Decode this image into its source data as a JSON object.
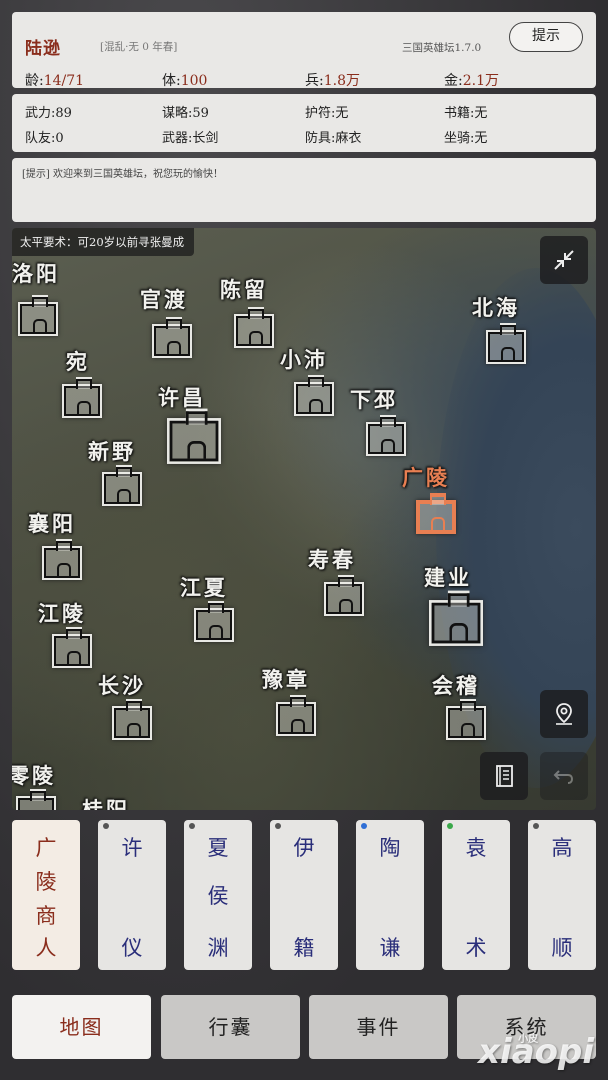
{
  "header": {
    "name": "陆逊",
    "era": "[混乱·无 0 年春]",
    "version": "三国英雄坛1.7.0",
    "hint_button": "提示",
    "stats": [
      {
        "label": "龄:",
        "value": "14/71"
      },
      {
        "label": "体:",
        "value": "100"
      },
      {
        "label": "兵:",
        "value": "1.8万"
      },
      {
        "label": "金:",
        "value": "2.1万"
      }
    ]
  },
  "attributes": {
    "row1": [
      {
        "label": "武力:",
        "value": "89"
      },
      {
        "label": "谋略:",
        "value": "59"
      },
      {
        "label": "护符:",
        "value": "无"
      },
      {
        "label": "书籍:",
        "value": "无"
      }
    ],
    "row2": [
      {
        "label": "队友:",
        "value": "0"
      },
      {
        "label": "武器:",
        "value": "长剑"
      },
      {
        "label": "防具:",
        "value": "麻衣"
      },
      {
        "label": "坐骑:",
        "value": "无"
      }
    ]
  },
  "tip": {
    "text": "[提示] 欢迎来到三国英雄坛，祝您玩的愉快！"
  },
  "map": {
    "hint": "太平要术：可20岁以前寻张曼成",
    "cities": [
      "洛阳",
      "官渡",
      "陈留",
      "北海",
      "宛",
      "小沛",
      "许昌",
      "下邳",
      "新野",
      "广陵",
      "襄阳",
      "寿春",
      "建业",
      "江夏",
      "江陵",
      "长沙",
      "豫章",
      "会稽",
      "零陵",
      "桂阳"
    ],
    "active_city": "广陵",
    "icons": {
      "collapse": "collapse-arrows-icon",
      "location": "map-pin-icon",
      "book": "book-icon",
      "back": "undo-arrow-icon"
    }
  },
  "characters": [
    {
      "name": "广陵商人",
      "type": "merchant"
    },
    {
      "name": [
        "许",
        "",
        "仪"
      ],
      "dot": "#555555"
    },
    {
      "name": [
        "夏",
        "侯",
        "渊"
      ],
      "dot": "#555555"
    },
    {
      "name": [
        "伊",
        "",
        "籍"
      ],
      "dot": "#555555"
    },
    {
      "name": [
        "陶",
        "",
        "谦"
      ],
      "dot": "#2f6fd6"
    },
    {
      "name": [
        "袁",
        "",
        "术"
      ],
      "dot": "#3aa84a"
    },
    {
      "name": [
        "高",
        "",
        "顺"
      ],
      "dot": "#555555"
    }
  ],
  "merchant_chars": [
    "广",
    "陵",
    "商",
    "人"
  ],
  "nav": {
    "map": "地图",
    "bag": "行囊",
    "events": "事件",
    "system": "系统"
  },
  "watermark": {
    "main": "xiaopi",
    "small": "小皮"
  },
  "colors": {
    "accent": "#8a2d1c",
    "active_city": "#e87f52",
    "char_name": "#2a2e7a"
  }
}
